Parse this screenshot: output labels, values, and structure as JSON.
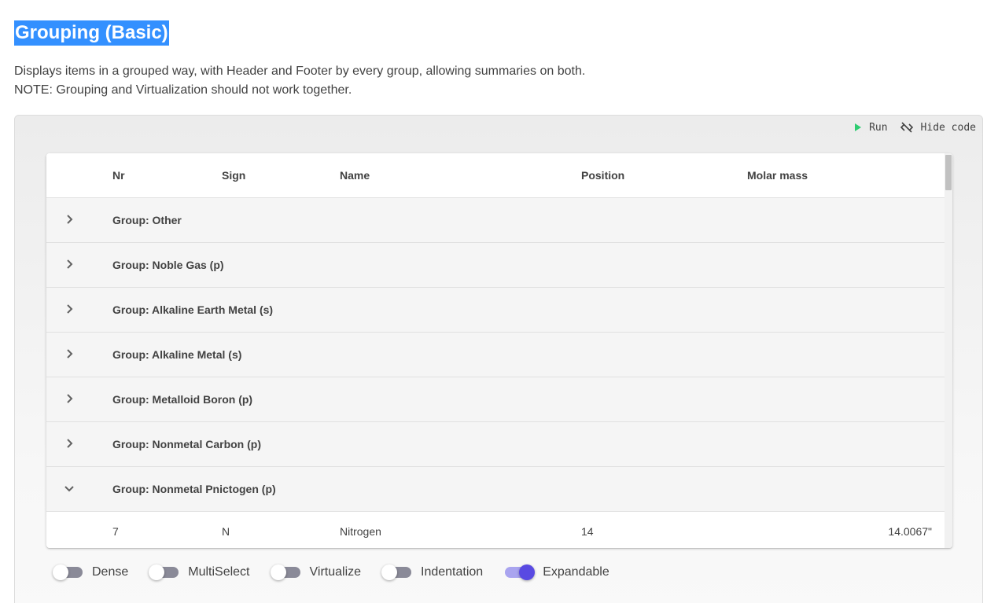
{
  "page": {
    "title": "Grouping (Basic)",
    "description_line1": "Displays items in a grouped way, with Header and Footer by every group, allowing summaries on both.",
    "description_line2": "NOTE: Grouping and Virtualization should not work together."
  },
  "demo": {
    "run_label": "Run",
    "hide_code_label": "Hide code",
    "run_icon": "play-icon",
    "hide_code_icon": "code-off-icon",
    "run_icon_color": "#2ecc71"
  },
  "table": {
    "columns": [
      "Nr",
      "Sign",
      "Name",
      "Position",
      "Molar mass"
    ],
    "groups": [
      {
        "label": "Group: Other",
        "expanded": false
      },
      {
        "label": "Group: Noble Gas (p)",
        "expanded": false
      },
      {
        "label": "Group: Alkaline Earth Metal (s)",
        "expanded": false
      },
      {
        "label": "Group: Alkaline Metal (s)",
        "expanded": false
      },
      {
        "label": "Group: Metalloid Boron (p)",
        "expanded": false
      },
      {
        "label": "Group: Nonmetal Carbon (p)",
        "expanded": false
      },
      {
        "label": "Group: Nonmetal Pnictogen (p)",
        "expanded": true
      }
    ],
    "rows": [
      {
        "nr": "7",
        "sign": "N",
        "name": "Nitrogen",
        "position": "14",
        "molar_mass": "14.0067\""
      }
    ]
  },
  "switches": [
    {
      "label": "Dense",
      "on": false
    },
    {
      "label": "MultiSelect",
      "on": false
    },
    {
      "label": "Virtualize",
      "on": false
    },
    {
      "label": "Indentation",
      "on": false
    },
    {
      "label": "Expandable",
      "on": true
    }
  ],
  "colors": {
    "accent": "#594ae2",
    "title_highlight": "#3390ff"
  }
}
